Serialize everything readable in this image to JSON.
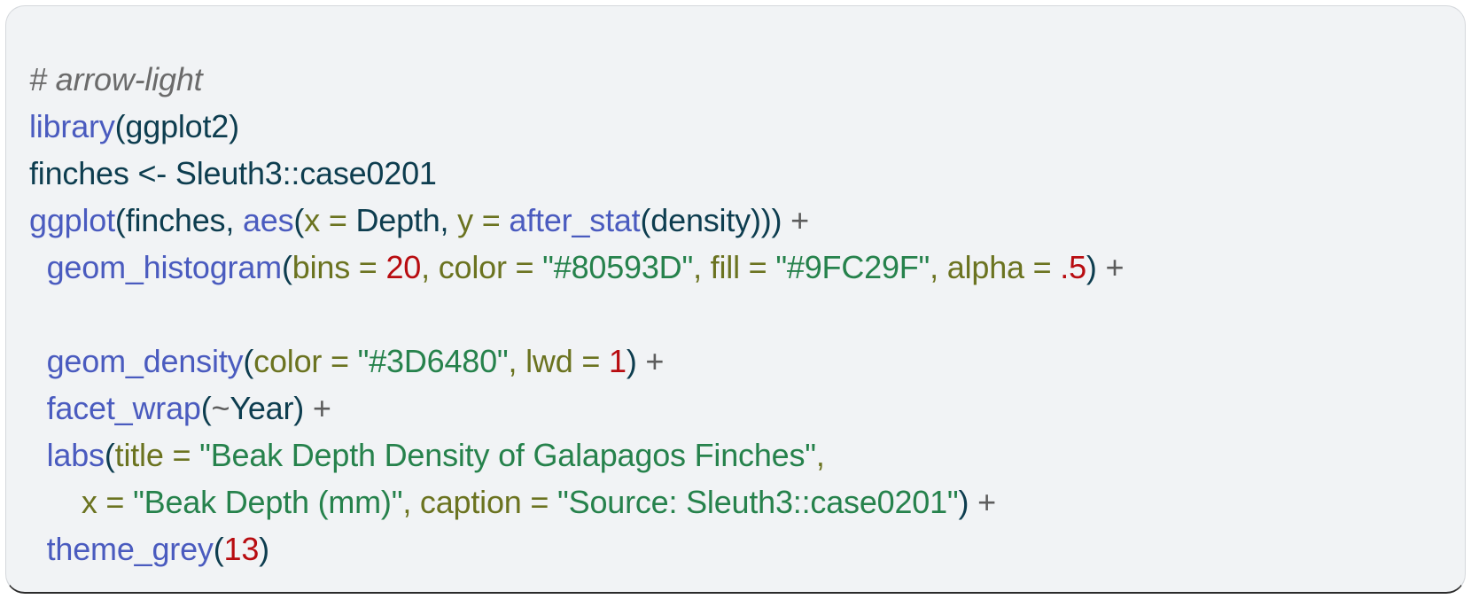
{
  "card": {
    "background": "#f1f3f5",
    "border_color": "#d5d8dc",
    "bottom_border_color": "#2b2b2b"
  },
  "theme": {
    "comment": "#6b6b6b",
    "function": "#4a5bbf",
    "identifier": "#0d3d4f",
    "argument": "#6b7320",
    "string": "#26824c",
    "number": "#b80c10",
    "operator": "#5d5d5d",
    "punctuation": "#0d3d4f"
  },
  "code": {
    "language": "r",
    "line1": {
      "comment": "# arrow-light"
    },
    "line2": {
      "func": "library",
      "open": "(",
      "arg": "ggplot2",
      "close": ")"
    },
    "line3": {
      "var": "finches",
      "assign": " <- ",
      "value": "Sleuth3::case0201"
    },
    "line4": {
      "func": "ggplot",
      "open": "(",
      "data": "finches, ",
      "aes_func": "aes",
      "aes_open": "(",
      "x_arg": "x",
      "eq1": " = ",
      "x_val": "Depth",
      "comma": ", ",
      "y_arg": "y",
      "eq2": " = ",
      "after_stat": "after_stat",
      "as_open": "(",
      "density": "density",
      "closers": ")))",
      "plus": " +"
    },
    "line5": {
      "indent": "  ",
      "func": "geom_histogram",
      "open": "(",
      "bins_arg": "bins",
      "eq1": " = ",
      "bins_val": "20",
      "comma1": ", ",
      "color_arg": "color",
      "eq2": " = ",
      "color_val": "\"#80593D\"",
      "comma2": ", ",
      "fill_arg": "fill",
      "eq3": " = ",
      "fill_val": "\"#9FC29F\"",
      "comma3": ", ",
      "alpha_arg": "alpha",
      "eq4": " = ",
      "alpha_val": ".5",
      "close": ")",
      "plus": " +"
    },
    "line6": {
      "blank": ""
    },
    "line7": {
      "indent": "  ",
      "func": "geom_density",
      "open": "(",
      "color_arg": "color",
      "eq1": " = ",
      "color_val": "\"#3D6480\"",
      "comma1": ", ",
      "lwd_arg": "lwd",
      "eq2": " = ",
      "lwd_val": "1",
      "close": ")",
      "plus": " +"
    },
    "line8": {
      "indent": "  ",
      "func": "facet_wrap",
      "open": "(",
      "tilde": "~",
      "var": "Year",
      "close": ")",
      "plus": " +"
    },
    "line9": {
      "indent": "  ",
      "func": "labs",
      "open": "(",
      "title_arg": "title",
      "eq1": " = ",
      "title_val": "\"Beak Depth Density of Galapagos Finches\"",
      "comma": ","
    },
    "line10": {
      "indent": "      ",
      "x_arg": "x",
      "eq1": " = ",
      "x_val": "\"Beak Depth (mm)\"",
      "comma": ", ",
      "caption_arg": "caption",
      "eq2": " = ",
      "caption_val": "\"Source: Sleuth3::case0201\"",
      "close": ")",
      "plus": " +"
    },
    "line11": {
      "indent": "  ",
      "func": "theme_grey",
      "open": "(",
      "size": "13",
      "close": ")"
    }
  }
}
